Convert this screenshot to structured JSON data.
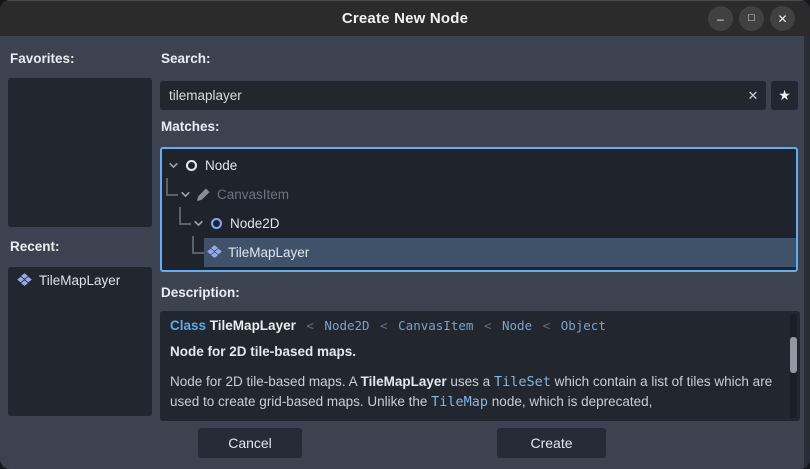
{
  "window": {
    "title": "Create New Node",
    "controls": {
      "minimize_glyph": "–",
      "maximize_glyph": "□",
      "close_glyph": "✕"
    }
  },
  "sidebar": {
    "favorites_label": "Favorites:",
    "recent_label": "Recent:",
    "recent_items": [
      {
        "label": "TileMapLayer",
        "icon": "tilemaplayer-icon"
      }
    ]
  },
  "search": {
    "label": "Search:",
    "value": "tilemaplayer",
    "clear_glyph": "✕",
    "favorite_glyph": "★"
  },
  "matches": {
    "label": "Matches:",
    "tree_items": [
      {
        "label": "Node",
        "icon": "node-icon",
        "depth": 0,
        "expandable": true,
        "disabled": false,
        "selected": false
      },
      {
        "label": "CanvasItem",
        "icon": "canvasitem-icon",
        "depth": 1,
        "expandable": true,
        "disabled": true,
        "selected": false
      },
      {
        "label": "Node2D",
        "icon": "node2d-icon",
        "depth": 2,
        "expandable": true,
        "disabled": false,
        "selected": false
      },
      {
        "label": "TileMapLayer",
        "icon": "tilemaplayer-icon",
        "depth": 3,
        "expandable": false,
        "disabled": false,
        "selected": true
      }
    ]
  },
  "description": {
    "label": "Description:",
    "class_prefix": "Class",
    "class_name": "TileMapLayer",
    "inheritance_separator": "<",
    "inheritance": [
      "Node2D",
      "CanvasItem",
      "Node",
      "Object"
    ],
    "brief": "Node for 2D tile-based maps.",
    "body_segments": [
      {
        "text": "Node for 2D tile-based maps. A ",
        "style": "normal"
      },
      {
        "text": "TileMapLayer",
        "style": "bold"
      },
      {
        "text": " uses a ",
        "style": "normal"
      },
      {
        "text": "TileSet",
        "style": "code"
      },
      {
        "text": " which contain a list of tiles which are used to create grid-based maps. Unlike the ",
        "style": "normal"
      },
      {
        "text": "TileMap",
        "style": "code"
      },
      {
        "text": " node, which is deprecated,",
        "style": "normal"
      }
    ]
  },
  "footer": {
    "cancel_label": "Cancel",
    "create_label": "Create"
  },
  "colors": {
    "body_bg": "#3c4250",
    "panel_bg": "#21262f",
    "titlebar_bg": "#2b2b2b",
    "focus_border": "#61aef2",
    "selection_bg": "#40526a",
    "icon_blue": "#8da5f3",
    "link_blue": "#63a8e6",
    "code_blue": "#8ab4dd",
    "text_primary": "#e5e8ee",
    "text_disabled": "#6d7480"
  }
}
